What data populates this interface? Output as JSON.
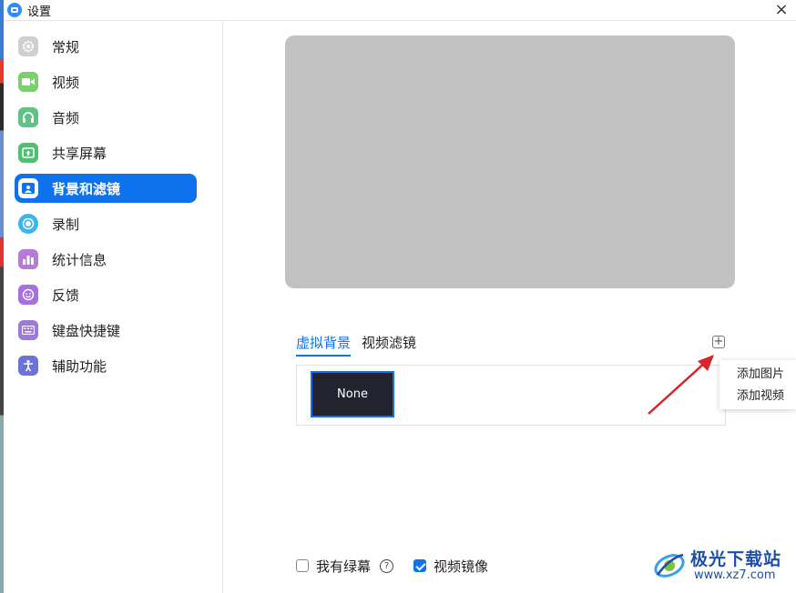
{
  "window": {
    "title": "设置",
    "close": "×"
  },
  "sidebar": {
    "items": [
      {
        "label": "常规",
        "icon": "gear-icon",
        "color": "#cfcfcf"
      },
      {
        "label": "视频",
        "icon": "video-icon",
        "color": "#7ccf6c"
      },
      {
        "label": "音频",
        "icon": "headphones-icon",
        "color": "#5fc383"
      },
      {
        "label": "共享屏幕",
        "icon": "share-screen-icon",
        "color": "#52bf73"
      },
      {
        "label": "背景和滤镜",
        "icon": "background-icon",
        "color": "#0e72ed",
        "active": true
      },
      {
        "label": "录制",
        "icon": "record-icon",
        "color": "#38b6f0"
      },
      {
        "label": "统计信息",
        "icon": "stats-icon",
        "color": "#b57bd9"
      },
      {
        "label": "反馈",
        "icon": "feedback-icon",
        "color": "#a86fe0"
      },
      {
        "label": "键盘快捷键",
        "icon": "keyboard-icon",
        "color": "#9b7ad8"
      },
      {
        "label": "辅助功能",
        "icon": "accessibility-icon",
        "color": "#6d72d8"
      }
    ]
  },
  "main": {
    "tabs": [
      {
        "label": "虚拟背景",
        "active": true
      },
      {
        "label": "视频滤镜",
        "active": false
      }
    ],
    "add_symbol": "+",
    "backgrounds": [
      {
        "label": "None"
      }
    ],
    "add_menu": [
      "添加图片",
      "添加视频"
    ],
    "options": {
      "green_screen": {
        "label": "我有绿幕",
        "checked": false
      },
      "help": "?",
      "mirror": {
        "label": "视频镜像",
        "checked": true
      }
    }
  },
  "watermark": {
    "title": "极光下载站",
    "url": "www.xz7.com"
  },
  "colors": {
    "accent": "#0e72ed",
    "preview": "#c2c2c2",
    "arrow": "#d7262a"
  }
}
